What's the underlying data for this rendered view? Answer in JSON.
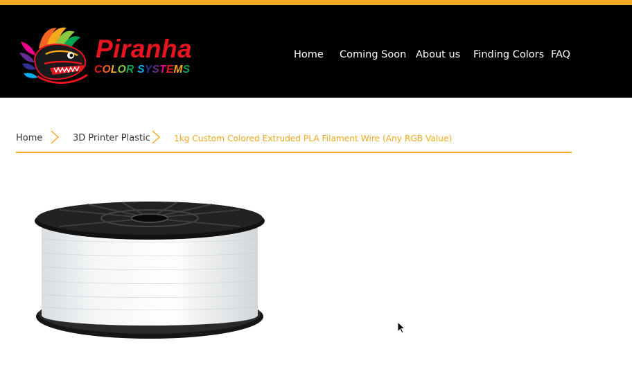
{
  "brand": {
    "name": "Piranha",
    "tagline": "COLOR SYSTEMS",
    "tagline_colors": [
      "#e11b22",
      "#f26522",
      "#f7a81b",
      "#8dc63f",
      "#00a651",
      "#00aeef",
      "#2e3192",
      "#662d91",
      "#ec008c",
      "#e11b22",
      "#f7a81b",
      "#00a651",
      "#00aeef"
    ]
  },
  "nav": {
    "items": [
      {
        "label": "Home"
      },
      {
        "label": "Coming Soon"
      },
      {
        "label": "About us"
      },
      {
        "label": "Finding Colors"
      },
      {
        "label": "FAQ"
      }
    ]
  },
  "breadcrumb": {
    "items": [
      {
        "label": "Home"
      },
      {
        "label": "3D Printer Plastic"
      },
      {
        "label": "1kg Custom Colored Extruded PLA Filament Wire (Any RGB Value)"
      }
    ]
  },
  "colors": {
    "accent": "#f4a81d",
    "header_bg": "#000000",
    "nav_text": "#ffffff",
    "logo_red": "#e8141e"
  },
  "product": {
    "image_icon": "filament-spool-icon"
  }
}
